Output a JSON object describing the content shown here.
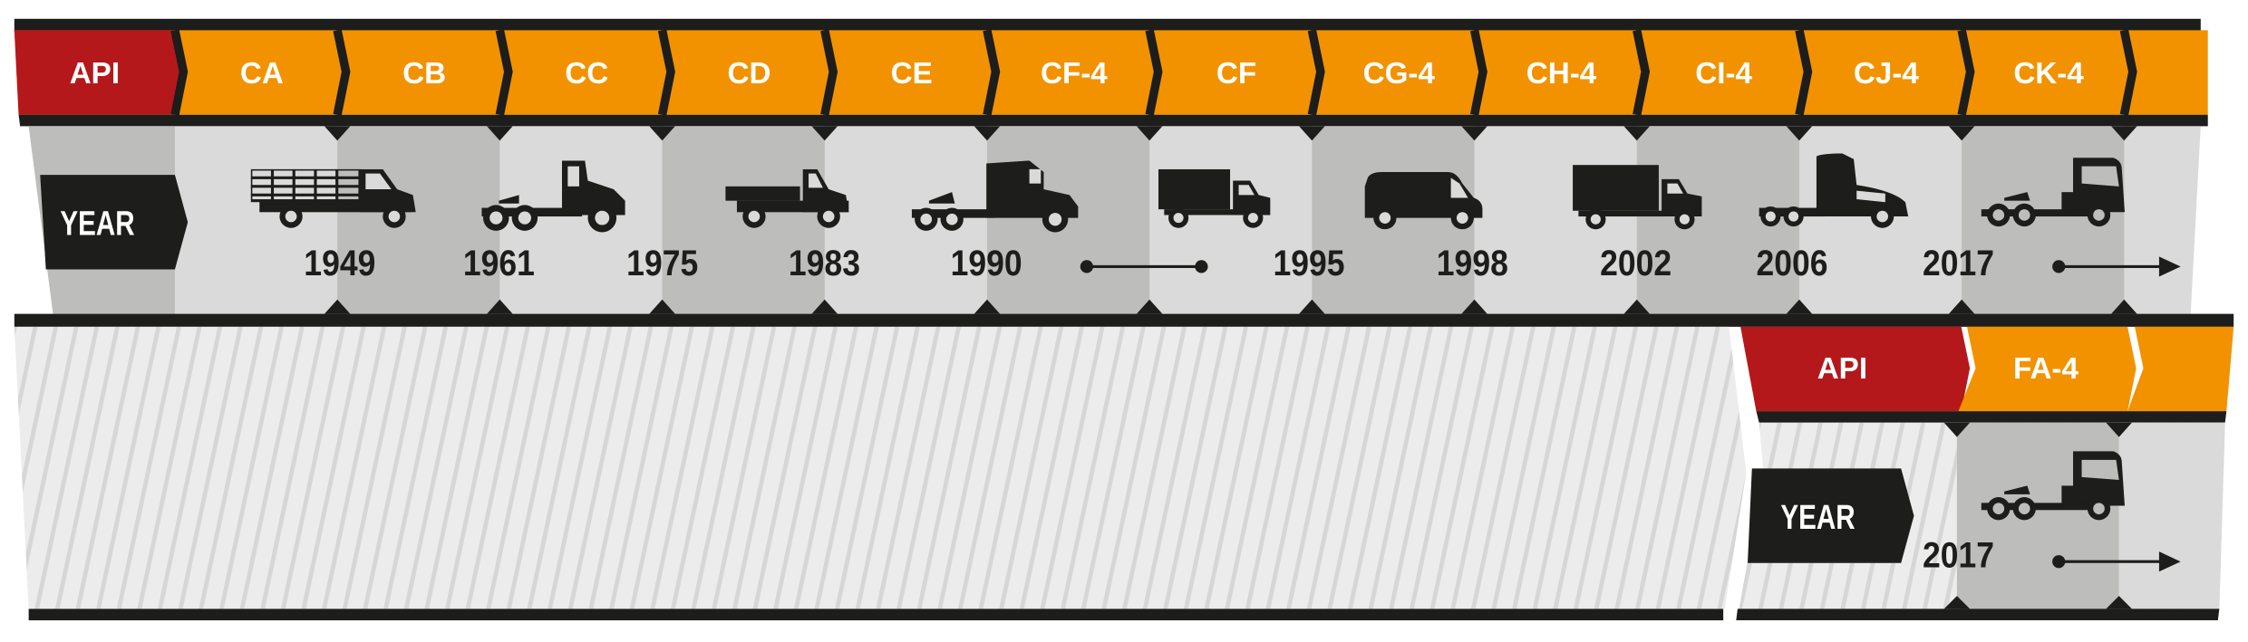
{
  "colors": {
    "api_red": "#b5181a",
    "category_orange": "#f29200",
    "frame_black": "#1d1d1b",
    "cell_light": "#dadada",
    "cell_dark": "#bdbdbc",
    "hatch_base": "#ececec",
    "hatch_stripe": "#d6d6d6"
  },
  "heavy_duty": {
    "api_label": "API",
    "year_label": "YEAR",
    "categories": [
      "CA",
      "CB",
      "CC",
      "CD",
      "CE",
      "CF-4",
      "CF",
      "CG-4",
      "CH-4",
      "CI-4",
      "CJ-4",
      "CK-4"
    ],
    "years": [
      "1949",
      "1961",
      "1975",
      "1983",
      "1990",
      "1995",
      "1998",
      "2002",
      "2006",
      "2017"
    ],
    "vehicles": [
      "stake-truck-icon",
      "tractor-truck-icon",
      "flatbed-truck-icon",
      "sleeper-tractor-icon",
      "box-truck-icon",
      "van-icon",
      "box-truck-large-icon",
      "modern-sleeper-tractor-icon",
      "day-cab-tractor-icon"
    ],
    "span_markers": [
      "range-line-icon",
      "ongoing-arrow-icon"
    ]
  },
  "fuel_economy": {
    "api_label": "API",
    "year_label": "YEAR",
    "categories": [
      "FA-4"
    ],
    "years": [
      "2017"
    ],
    "vehicles": [
      "day-cab-tractor-icon"
    ],
    "span_markers": [
      "ongoing-arrow-icon"
    ]
  }
}
